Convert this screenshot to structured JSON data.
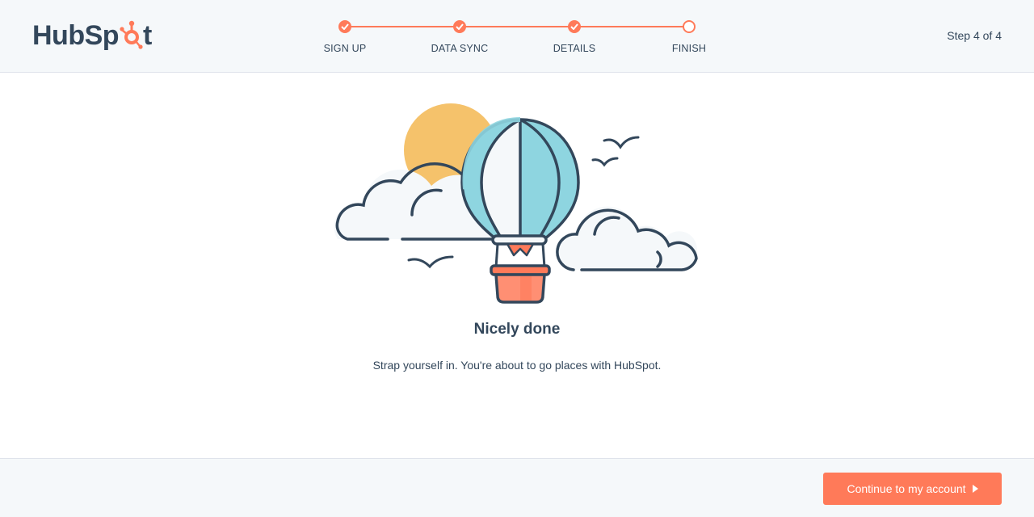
{
  "brand": {
    "logo_text_left": "HubSp",
    "logo_text_right": "t",
    "accent_color": "#ff7a59",
    "text_color": "#33475b"
  },
  "stepper": {
    "steps": [
      {
        "label": "SIGN UP",
        "status": "done"
      },
      {
        "label": "DATA SYNC",
        "status": "done"
      },
      {
        "label": "DETAILS",
        "status": "done"
      },
      {
        "label": "FINISH",
        "status": "current"
      }
    ],
    "step_count": "Step 4 of 4"
  },
  "main": {
    "title": "Nicely done",
    "subtitle": "Strap yourself in. You're about to go places with HubSpot.",
    "illustration_icon": "hot-air-balloon-illustration"
  },
  "footer": {
    "continue_label": "Continue to my account"
  }
}
